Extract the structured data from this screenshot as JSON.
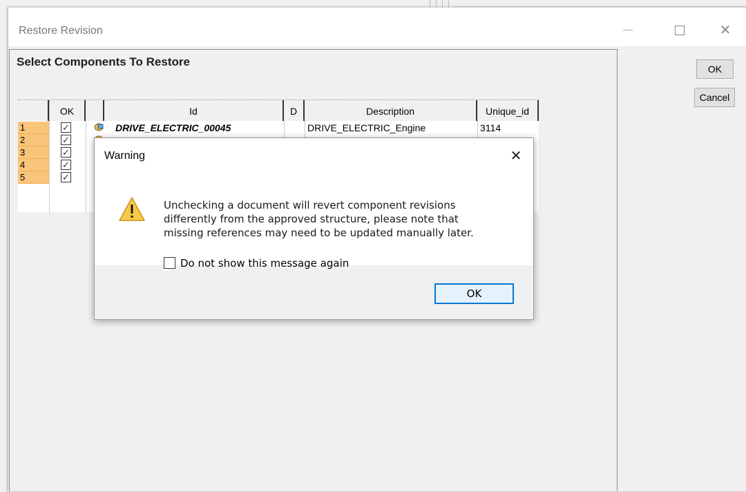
{
  "window": {
    "title": "Restore Revision",
    "heading": "Select Components To Restore",
    "ok_label": "OK",
    "cancel_label": "Cancel"
  },
  "grid": {
    "columns": [
      "",
      "OK",
      "",
      "Id",
      "D",
      "Description",
      "Unique_id"
    ],
    "rows": [
      {
        "num": "1",
        "checked": true,
        "id": "DRIVE_ELECTRIC_00045",
        "description": "DRIVE_ELECTRIC_Engine",
        "unique_id": "3114"
      },
      {
        "num": "2",
        "checked": true,
        "id": "",
        "description": "",
        "unique_id": ""
      },
      {
        "num": "3",
        "checked": true,
        "id": "",
        "description": "",
        "unique_id": ""
      },
      {
        "num": "4",
        "checked": true,
        "id": "",
        "description": "",
        "unique_id": ""
      },
      {
        "num": "5",
        "checked": true,
        "id": "",
        "description": "",
        "unique_id": ""
      }
    ]
  },
  "warning": {
    "title": "Warning",
    "message_lines": [
      "Unchecking a document will revert component revisions",
      "differently from the approved structure, please note that",
      "missing references may need to be updated manually later."
    ],
    "checkbox_label": "Do not show this message again",
    "checkbox_checked": false,
    "ok_label": "OK"
  },
  "colors": {
    "row_header": "#f9c57a",
    "dialog_button_border": "#0078d7",
    "warning_yellow": "#f7c948"
  },
  "icons": [
    "minimize-icon",
    "maximize-icon",
    "close-icon",
    "component-icon",
    "warning-icon",
    "checkbox-checked-icon"
  ]
}
